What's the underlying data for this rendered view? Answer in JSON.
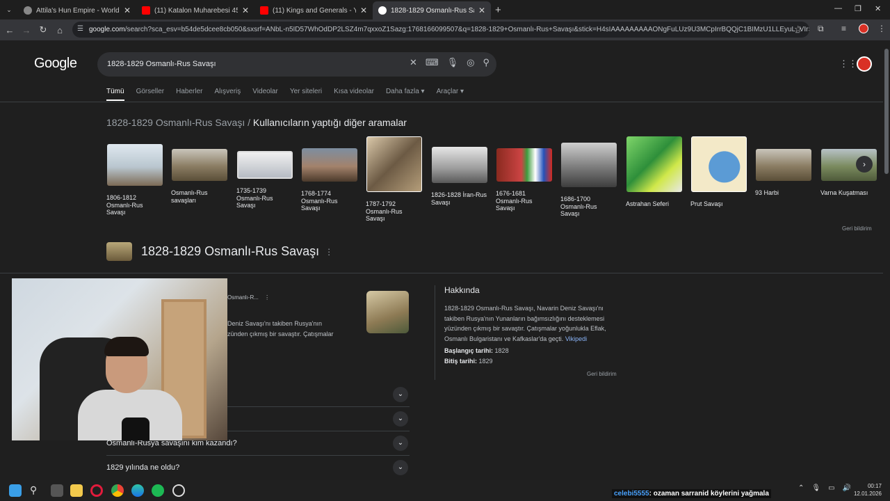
{
  "browser": {
    "tabs": [
      {
        "title": "Attila's Hun Empire - World His",
        "favicon": "generic-icon"
      },
      {
        "title": "(11) Katalon Muharebesi 451 -",
        "favicon": "youtube-icon"
      },
      {
        "title": "(11) Kings and Generals - YouT",
        "favicon": "youtube-icon"
      },
      {
        "title": "1828-1829 Osmanlı-Rus Savaş",
        "favicon": "google-icon"
      }
    ],
    "new_tab": "+",
    "url_domain": "google.com",
    "url_rest": "/search?sca_esv=b54de5dcee8cb050&sxsrf=ANbL-n5ID57WhOdDP2LSZ4m7qxxoZ1Sazg:1768166099507&q=1828-1829+Osmanlı-Rus+Savaşı&stick=H4sIAAAAAAAAAONgFuLUz9U3MCpIrrBQQjC1BIMzU1LLEyuL_VIrSoJLUguKfzHq..."
  },
  "google": {
    "logo": "Google",
    "query": "1828-1829 Osmanlı-Rus Savaşı",
    "nav": [
      "Tümü",
      "Görseller",
      "Haberler",
      "Alışveriş",
      "Videolar",
      "Yer siteleri",
      "Kısa videolar",
      "Daha fazla",
      "Araçlar"
    ]
  },
  "related": {
    "prefix": "1828-1829 Osmanlı-Rus Savaşı",
    "sep": " / ",
    "title": "Kullanıcıların yaptığı diğer aramalar",
    "items": [
      "1806-1812 Osmanlı-Rus Savaşı",
      "Osmanlı-Rus savaşları",
      "1735-1739 Osmanlı-Rus Savaşı",
      "1768-1774 Osmanlı-Rus Savaşı",
      "1787-1792 Osmanlı-Rus Savaşı",
      "1826-1828 İran-Rus Savaşı",
      "1676-1681 Osmanlı-Rus Savaşı",
      "1686-1700 Osmanlı-Rus Savaşı",
      "Astrahan Seferi",
      "Prut Savaşı",
      "93 Harbi",
      "Varna Kuşatması"
    ],
    "feedback": "Geri bildirim"
  },
  "entity": {
    "name": "1828-1829 Osmanlı-Rus Savaşı",
    "snippet_source": "Osmanlı-R...",
    "snippet_line1": "Deniz Savaşı'nı takiben Rusya'nın",
    "snippet_line2": "zünden çıkmış bir savaştır. Çatışmalar",
    "about_title": "Hakkında",
    "about_text": "1828-1829 Osmanlı-Rus Savaşı, Navarin Deniz Savaşı'nı takiben Rusya'nın Yunanların bağımsızlığını desteklemesi yüzünden çıkmış bir savaştır. Çatışmalar yoğunlukla Eflak, Osmanlı Bulgaristanı ve Kafkaslar'da geçti.",
    "wiki_link": "Vikipedi",
    "start_label": "Başlangıç tarihi:",
    "start_value": "1828",
    "end_label": "Bitiş tarihi:",
    "end_value": "1829",
    "feedback": "Geri bildirim"
  },
  "faq": [
    "Osmanlı-Rusya savaşını kim kazandı?",
    "1829 yılında ne oldu?"
  ],
  "overlay": {
    "chat_user": "celebi5555",
    "chat_msg": ": ozaman sarranid köylerini yağmala"
  },
  "clock": {
    "time": "00:17",
    "date": "12.01.2026"
  }
}
